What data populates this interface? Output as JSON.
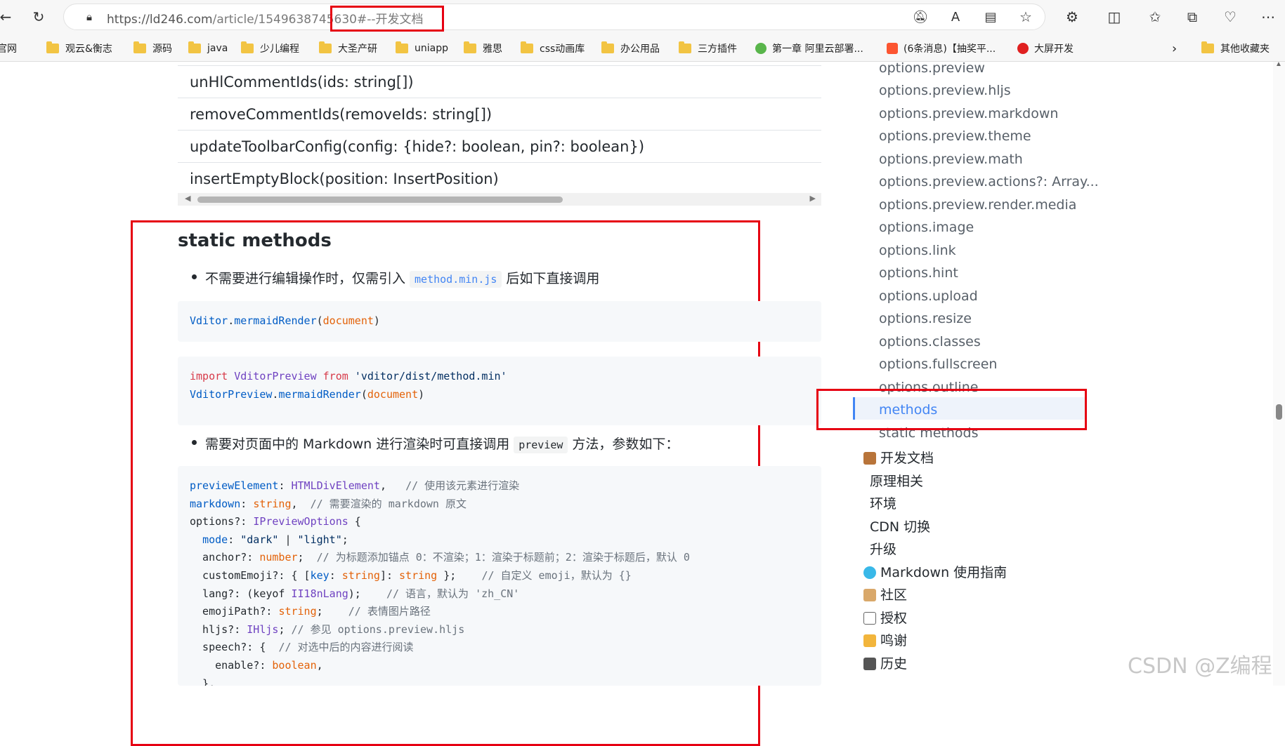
{
  "browser": {
    "url_host": "https://ld246.com",
    "url_path": "/article/1549638745630",
    "url_hash": "#--开发文档",
    "icons": [
      "back-icon",
      "reload-icon",
      "lock-icon",
      "mute-icon",
      "read-aloud-icon",
      "immersive-reader-icon",
      "favorite-star-icon",
      "extensions-icon",
      "split-screen-icon",
      "favorites-icon",
      "collections-icon",
      "browser-essentials-icon",
      "more-icon"
    ],
    "menu_label": "⋯"
  },
  "bookmarks": [
    "官网",
    "观云&衡志",
    "源码",
    "java",
    "少儿编程",
    "大圣产研",
    "uniapp",
    "雅思",
    "css动画库",
    "办公用品",
    "三方插件",
    "第一章 阿里云部署...",
    "(6条消息)【抽奖平...",
    "大屏开发",
    "其他收藏夹"
  ],
  "main": {
    "table_rows": [
      "unHlCommentIds(ids: string[])",
      "removeCommentIds(removeIds: string[])",
      "updateToolbarConfig(config: {hide?: boolean, pin?: boolean})",
      "insertEmptyBlock(position: InsertPosition)"
    ],
    "heading": "static methods",
    "bullet1_pre": "不需要进行编辑操作时，仅需引入",
    "bullet1_code": "method.min.js",
    "bullet1_post": "后如下直接调用",
    "bullet2_pre": "需要对页面中的 Markdown 进行渲染时可直接调用",
    "bullet2_code": "preview",
    "bullet2_post": "方法，参数如下："
  },
  "toc": {
    "items": [
      "options.preview",
      "options.preview.hljs",
      "options.preview.markdown",
      "options.preview.theme",
      "options.preview.math",
      "options.preview.actions?: Array...",
      "options.preview.render.media",
      "options.image",
      "options.link",
      "options.hint",
      "options.upload",
      "options.resize",
      "options.classes",
      "options.fullscreen",
      "options.outline",
      "methods",
      "static methods"
    ],
    "active": "methods",
    "sections": [
      "开发文档",
      "原理相关",
      "环境",
      "CDN 切换",
      "升级",
      "Markdown 使用指南",
      "社区",
      "授权",
      "鸣谢",
      "历史"
    ]
  },
  "watermark": "CSDN @Z编程",
  "colors": {
    "accent": "#4285f4",
    "highlight_box": "#e60012",
    "folder": "#f2c443"
  }
}
